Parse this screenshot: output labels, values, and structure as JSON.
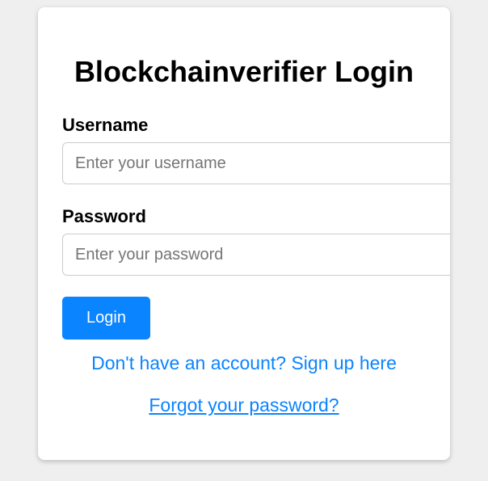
{
  "login_form": {
    "title": "Blockchainverifier Login",
    "username_label": "Username",
    "username_placeholder": "Enter your username",
    "username_value": "",
    "password_label": "Password",
    "password_placeholder": "Enter your password",
    "password_value": "",
    "login_button": "Login",
    "signup_link": "Don't have an account? Sign up here",
    "forgot_link": "Forgot your password?"
  },
  "colors": {
    "accent": "#0a84ff",
    "background": "#efefef",
    "card": "#ffffff"
  }
}
